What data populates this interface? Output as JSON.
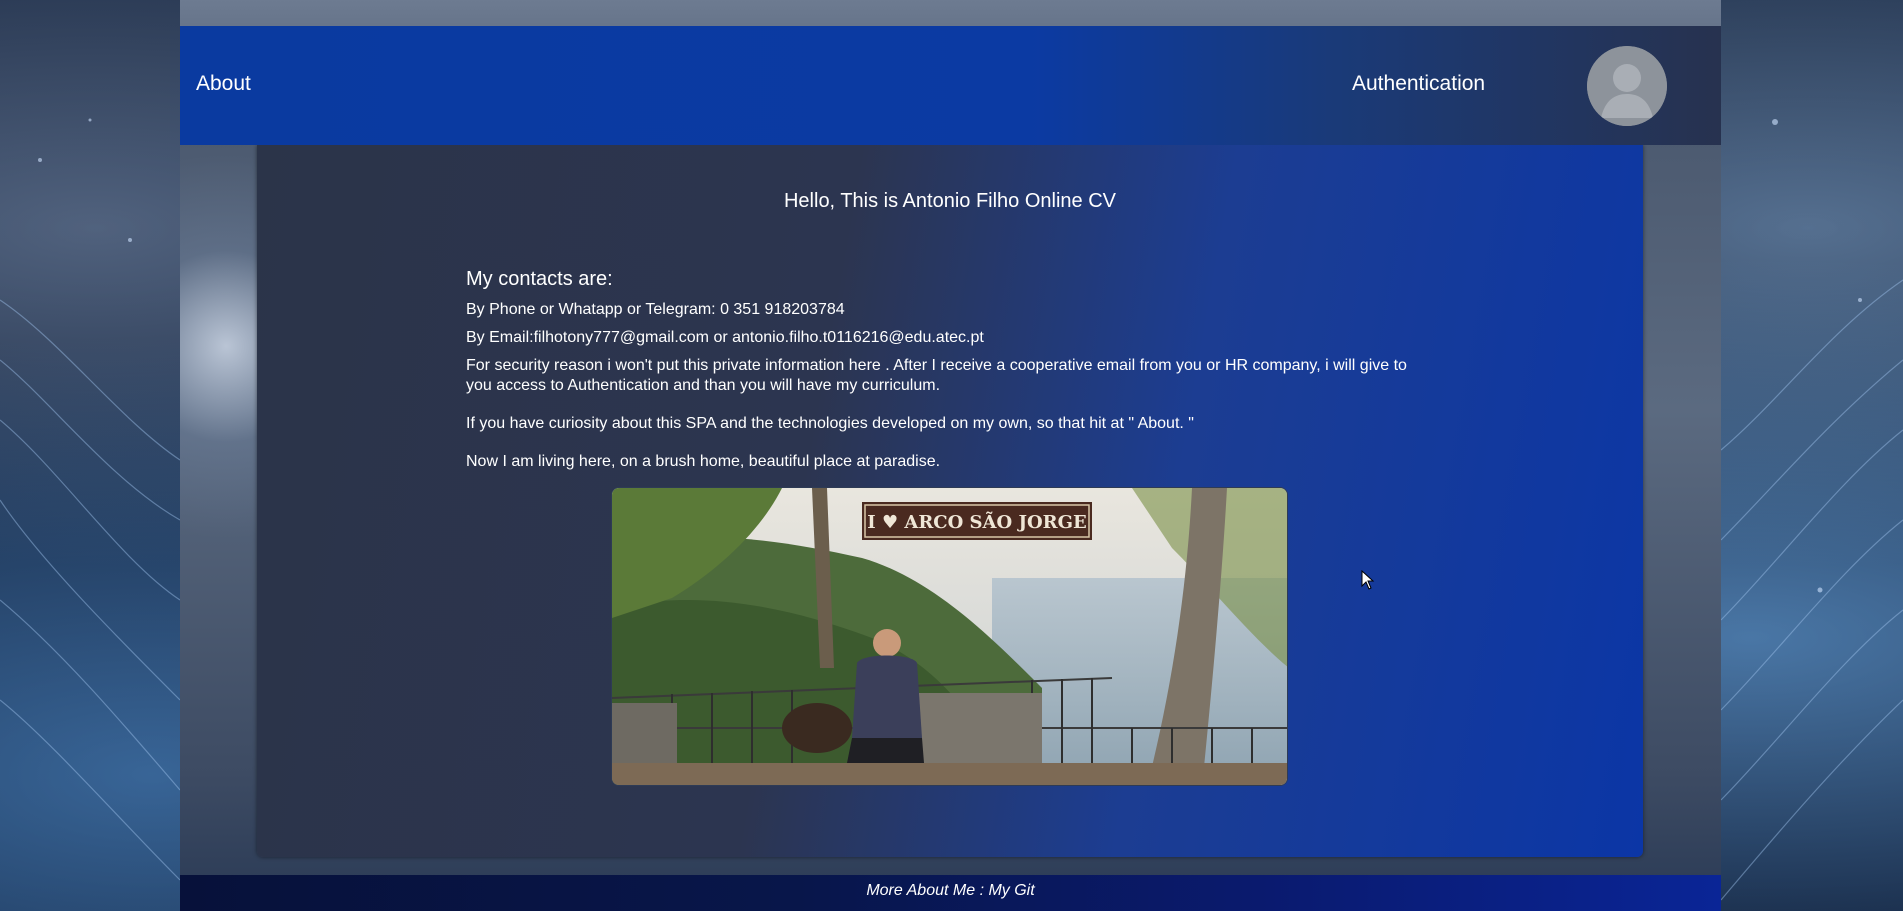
{
  "navbar": {
    "about_label": "About",
    "auth_label": "Authentication",
    "avatar_icon": "user-avatar-icon"
  },
  "main": {
    "greeting": "Hello, This is Antonio Filho Online CV",
    "contacts_title": "My contacts are:",
    "phone_line": "By Phone or Whatapp or Telegram: 0 351 918203784",
    "email_line": "By Email:filhotony777@gmail.com or antonio.filho.t0116216@edu.atec.pt",
    "security_line": "For security reason i won't put this private information here . After I receive a cooperative email from you or HR company, i will give to you access to Authentication and than you will have my curriculum.",
    "spa_line": "If you have curiosity about this SPA and the technologies developed on my own, so that hit at \" About. \"",
    "living_line": "Now I am living here, on a brush home, beautiful place at paradise.",
    "photo_sign_text": "I ♥ ARCO SÃO JORGE"
  },
  "footer": {
    "more_label": "More About Me : ",
    "git_label": "My Git"
  },
  "colors": {
    "navbar_blue": "#0b3aa3",
    "panel_dark": "#2b3449",
    "panel_blue": "#0b36a6",
    "footer_dark": "#07113a"
  }
}
